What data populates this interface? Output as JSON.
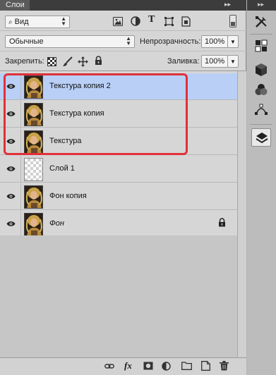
{
  "panel": {
    "tab_label": "Слои",
    "tab_menu_glyph": "▸▸",
    "tab_more_glyph": "≡"
  },
  "filter": {
    "kind_label": "Вид",
    "search_glyph": "⌕",
    "icons": [
      "image-filter-icon",
      "adjustment-filter-icon",
      "type-filter-icon",
      "shape-filter-icon",
      "smart-object-filter-icon"
    ]
  },
  "blend": {
    "mode": "Обычные",
    "opacity_label": "Непрозрачность:",
    "opacity_value": "100%"
  },
  "lock": {
    "label": "Закрепить:",
    "fill_label": "Заливка:",
    "fill_value": "100%",
    "icons": [
      "lock-transparent-icon",
      "lock-paint-icon",
      "lock-move-icon",
      "lock-all-icon"
    ]
  },
  "layers": [
    {
      "name": "Текстура копия 2",
      "selected": true,
      "thumb": "portrait",
      "locked": false,
      "italic": false
    },
    {
      "name": "Текстура копия",
      "selected": false,
      "thumb": "portrait",
      "locked": false,
      "italic": false
    },
    {
      "name": "Текстура",
      "selected": false,
      "thumb": "portrait",
      "locked": false,
      "italic": false
    },
    {
      "name": "Слой 1",
      "selected": false,
      "thumb": "transparent",
      "locked": false,
      "italic": false
    },
    {
      "name": "Фон копия",
      "selected": false,
      "thumb": "portrait",
      "locked": false,
      "italic": false
    },
    {
      "name": "Фон",
      "selected": false,
      "thumb": "portrait",
      "locked": true,
      "italic": true
    }
  ],
  "bottom_bar": {
    "fx_label": "fx",
    "icons": [
      "link-layers-icon",
      "fx-icon",
      "add-mask-icon",
      "adjustment-layer-icon",
      "new-group-icon",
      "new-layer-icon",
      "delete-layer-icon"
    ]
  },
  "tool_strip": {
    "top_glyph": "▸▸",
    "buttons": [
      "tools-icon",
      "swatches-icon",
      "3d-cube-icon",
      "channels-icon",
      "paths-icon",
      "layers-panel-icon"
    ]
  },
  "colors": {
    "selected_row": "#b9cff6",
    "highlight_box": "#e0303a"
  }
}
